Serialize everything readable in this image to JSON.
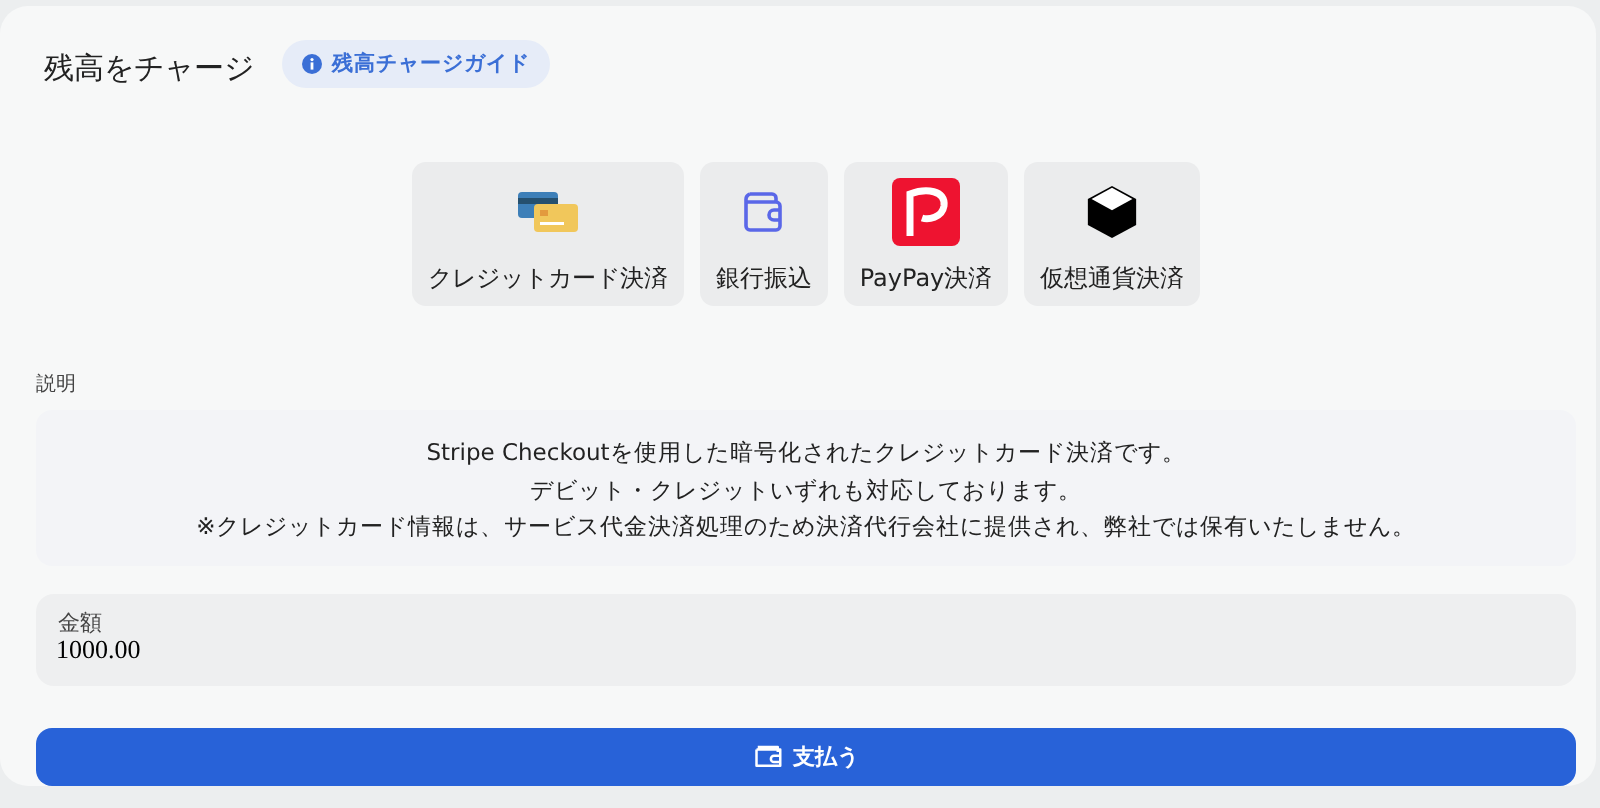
{
  "title": "残高をチャージ",
  "guide_badge": {
    "label": "残高チャージガイド"
  },
  "payment_methods": [
    {
      "kind": "card",
      "label": "クレジットカード決済"
    },
    {
      "kind": "bank",
      "label": "銀行振込"
    },
    {
      "kind": "paypay",
      "label": "PayPay決済"
    },
    {
      "kind": "crypto",
      "label": "仮想通貨決済"
    }
  ],
  "description": {
    "label": "説明",
    "lines": [
      "Stripe Checkoutを使用した暗号化されたクレジットカード決済です。",
      "デビット・クレジットいずれも対応しております。",
      "※クレジットカード情報は、サービス代金決済処理のため決済代行会社に提供され、弊社では保有いたしません。"
    ]
  },
  "amount": {
    "label": "金額",
    "value": "1000.00"
  },
  "pay_button": {
    "label": "支払う"
  }
}
